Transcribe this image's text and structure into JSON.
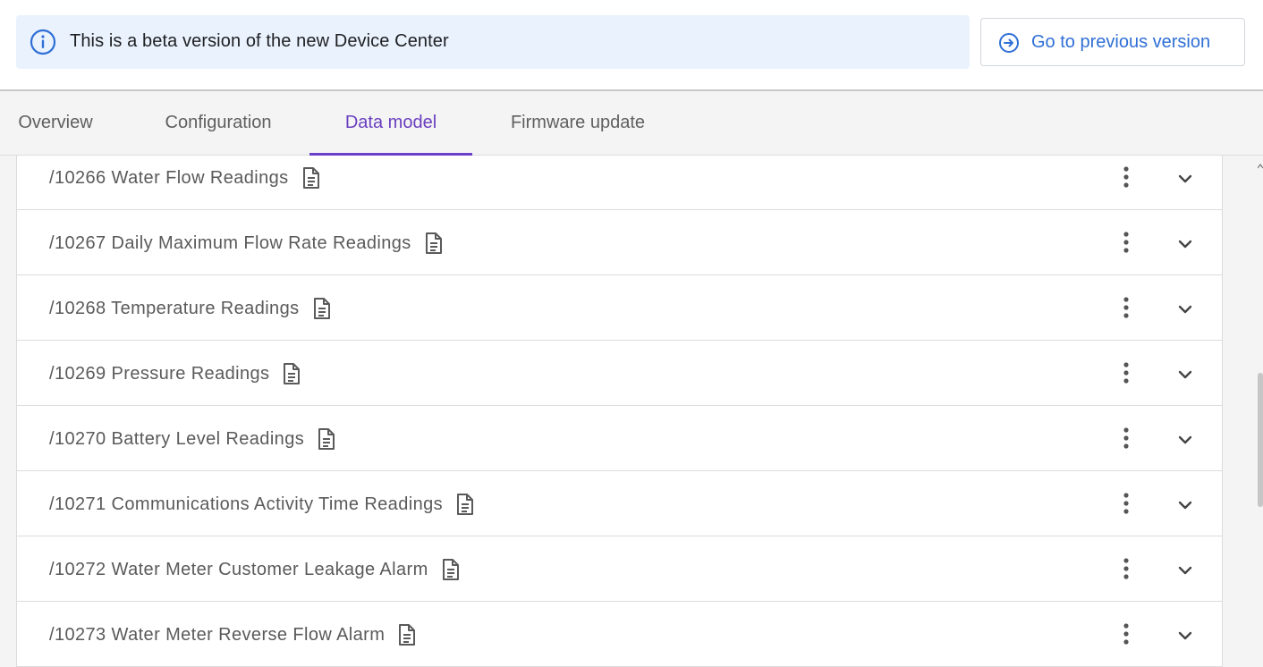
{
  "banner": {
    "message": "This is a beta version of the new Device Center",
    "icon": "info-icon",
    "background": "#eaf2fd"
  },
  "prev_button": {
    "label": "Go to previous version",
    "icon": "arrow-circle-right-icon",
    "color": "#2f6fd6"
  },
  "tabs": [
    {
      "label": "Overview",
      "active": false
    },
    {
      "label": "Configuration",
      "active": false
    },
    {
      "label": "Data model",
      "active": true
    },
    {
      "label": "Firmware update",
      "active": false
    }
  ],
  "accent_color": "#6b3fc8",
  "objects": [
    {
      "title": "/10266 Water Flow Readings"
    },
    {
      "title": "/10267 Daily Maximum Flow Rate Readings"
    },
    {
      "title": "/10268 Temperature Readings"
    },
    {
      "title": "/10269 Pressure Readings"
    },
    {
      "title": "/10270 Battery Level Readings"
    },
    {
      "title": "/10271 Communications Activity Time Readings"
    },
    {
      "title": "/10272 Water Meter Customer Leakage Alarm"
    },
    {
      "title": "/10273 Water Meter Reverse Flow Alarm"
    }
  ],
  "row_icons": {
    "doc": "document-icon",
    "menu": "more-vertical-icon",
    "expand": "chevron-down-icon"
  }
}
